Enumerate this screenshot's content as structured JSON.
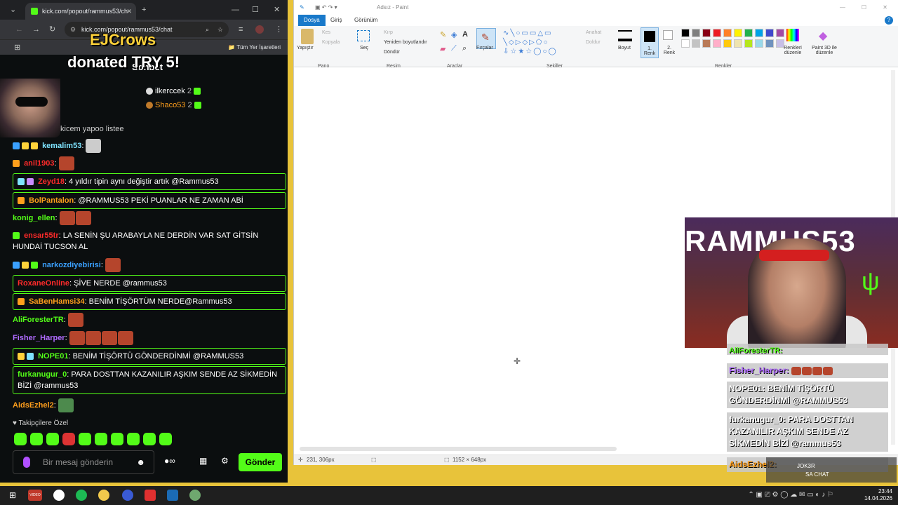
{
  "browser": {
    "tab_title": "kick.com/popout/rammus53/ch",
    "url": "kick.com/popout/rammus53/chat",
    "bookmarks_label": "Tüm Yer İşaretleri"
  },
  "chat": {
    "title": "Sohbet",
    "donation": {
      "name": "EJCrows",
      "text": "donated TRY 5!"
    },
    "top_donors": [
      {
        "name": "ilkerccek",
        "count": "2"
      },
      {
        "name": "Shaco53",
        "count": "2"
      }
    ],
    "partial_line": "kicem yapoo listee",
    "messages": [
      {
        "user": "kemalim53",
        "text": ":",
        "color": "#7ee3ff"
      },
      {
        "user": "anil1903",
        "text": ":",
        "color": "#ff2a2a"
      },
      {
        "user": "Zeyd18",
        "text": ": 4 yıldır tipin aynı değiştir artık @Rammus53",
        "color": "#ff2a2a",
        "highlight": true
      },
      {
        "user": "BolPantalon",
        "text": ": @RAMMUS53 PEKİ PUANLAR NE ZAMAN ABİ",
        "color": "#ff9f1c",
        "highlight": true
      },
      {
        "user": "konig_ellen",
        "text": ":",
        "color": "#53fc18"
      },
      {
        "user": "ensar55tr",
        "text": ": LA SENİN ŞU ARABAYLA NE DERDİN VAR SAT GİTSİN HUNDAİ TUCSON AL",
        "color": "#ff2a2a"
      },
      {
        "user": "narkozdiyebirisi",
        "text": ":",
        "color": "#3aa0ff"
      },
      {
        "user": "RoxaneOnline",
        "text": ": ŞİVE NERDE @rammus53",
        "color": "#ff2a2a",
        "highlight": true
      },
      {
        "user": "SaBenHamsi34",
        "text": ": BENİM TİŞÖRTÜM NERDE@Rammus53",
        "color": "#ff9f1c",
        "highlight": true
      },
      {
        "user": "AliForesterTR",
        "text": ":",
        "color": "#53fc18"
      },
      {
        "user": "Fisher_Harper",
        "text": ":",
        "color": "#b06bff"
      },
      {
        "user": "NOPE01",
        "text": ": BENİM TİŞÖRTÜ GÖNDERDİNMİ @RAMMUS53",
        "color": "#53fc18",
        "highlight": true
      },
      {
        "user": "furkanugur_0",
        "text": ": PARA DOSTTAN KAZANILIR AŞKIM SENDE AZ SİKMEDİN BİZİ @rammus53",
        "color": "#53fc18",
        "highlight": true
      },
      {
        "user": "AidsEzhel2",
        "text": ":",
        "color": "#ff9f1c"
      }
    ],
    "followers_only": "Takipçilere Özel",
    "input_placeholder": "Bir mesaj gönderin",
    "send_label": "Gönder"
  },
  "paint": {
    "title": "Adsız - Paint",
    "tabs": [
      "Dosya",
      "Giriş",
      "Görünüm"
    ],
    "ribbon": {
      "paste": "Yapıştır",
      "cut": "Kes",
      "copy": "Kopyala",
      "select": "Seç",
      "crop": "Kırp",
      "resize": "Yeniden boyutlandır",
      "rotate": "Döndür",
      "brushes": "Fırçalar",
      "outline": "Anahat",
      "fill": "Doldur",
      "size": "Boyut",
      "color1": "1. Renk",
      "color2": "2. Renk",
      "edit_colors": "Renkleri düzenle",
      "paint3d": "Paint 3D ile düzenle"
    },
    "groups": [
      "Pano",
      "Resim",
      "Araçlar",
      "Şekiller",
      "Renkler"
    ],
    "palette": [
      "#000000",
      "#7f7f7f",
      "#880015",
      "#ed1c24",
      "#ff7f27",
      "#fff200",
      "#22b14c",
      "#00a2e8",
      "#3f48cc",
      "#a349a4",
      "#ffffff",
      "#c3c3c3",
      "#b97a57",
      "#ffaec9",
      "#ffc90e",
      "#efe4b0",
      "#b5e61d",
      "#99d9ea",
      "#7092be",
      "#c8bfe7"
    ],
    "status": {
      "cursor": "231, 306px",
      "size": "1152 × 648px"
    }
  },
  "overlay": {
    "banner": "RAMMUS53",
    "messages": [
      {
        "text": "AliForesterTR:"
      },
      {
        "text": "Fisher_Harper:"
      },
      {
        "text": "NOPE01: BENİM TİŞÖRTÜ GÖNDERDİNMİ @RAMMUS53"
      },
      {
        "text": "furkanugur_0: PARA DOSTTAN KAZANILIR AŞKIM SENDE AZ SİKMEDİN BİZİ @rammus53"
      },
      {
        "text": "AidsEzhel2:"
      }
    ],
    "joker": {
      "name": "JOK3R",
      "line": "SA CHAT"
    }
  },
  "taskbar": {
    "time": "23:44",
    "date": "14.04.2026",
    "badge": "VIDEO"
  }
}
